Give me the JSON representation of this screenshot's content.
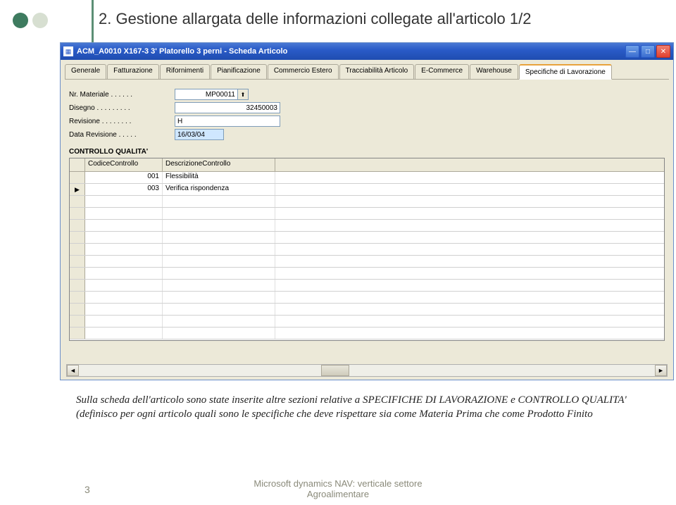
{
  "slide": {
    "title": "2. Gestione allargata delle informazioni collegate all'articolo 1/2",
    "body": "Sulla scheda dell'articolo sono state inserite altre sezioni relative a SPECIFICHE DI LAVORAZIONE e CONTROLLO QUALITA' (definisco per ogni articolo quali sono le specifiche che deve rispettare sia come Materia Prima che come Prodotto Finito",
    "page_num": "3",
    "footer_line1": "Microsoft dynamics NAV: verticale settore",
    "footer_line2": "Agroalimentare"
  },
  "window": {
    "title": "ACM_A0010 X167-3 3' Platorello 3 perni - Scheda Articolo",
    "tabs": [
      {
        "label": "Generale"
      },
      {
        "label": "Fatturazione"
      },
      {
        "label": "Rifornimenti"
      },
      {
        "label": "Pianificazione"
      },
      {
        "label": "Commercio Estero"
      },
      {
        "label": "Tracciabilità Articolo"
      },
      {
        "label": "E-Commerce"
      },
      {
        "label": "Warehouse"
      },
      {
        "label": "Specifiche di Lavorazione"
      }
    ],
    "active_tab": 8,
    "fields": {
      "nr_materiale_label": "Nr. Materiale  .  .  .  .  .  .",
      "nr_materiale_value": "MP00011",
      "disegno_label": "Disegno .  .  .  .  .  .  .  .  .",
      "disegno_value": "32450003",
      "revisione_label": "Revisione  .  .  .  .  .  .  .  .",
      "revisione_value": "H",
      "data_revisione_label": "Data Revisione  .  .  .  .  .",
      "data_revisione_value": "16/03/04"
    },
    "section_header": "CONTROLLO QUALITA'",
    "grid": {
      "columns": [
        "CodiceControllo",
        "DescrizioneControllo"
      ],
      "rows": [
        {
          "marker": "",
          "codice": "001",
          "descr": "Flessibilità"
        },
        {
          "marker": "▶",
          "codice": "003",
          "descr": "Verifica rispondenza"
        }
      ],
      "empty_rows": 12
    }
  }
}
